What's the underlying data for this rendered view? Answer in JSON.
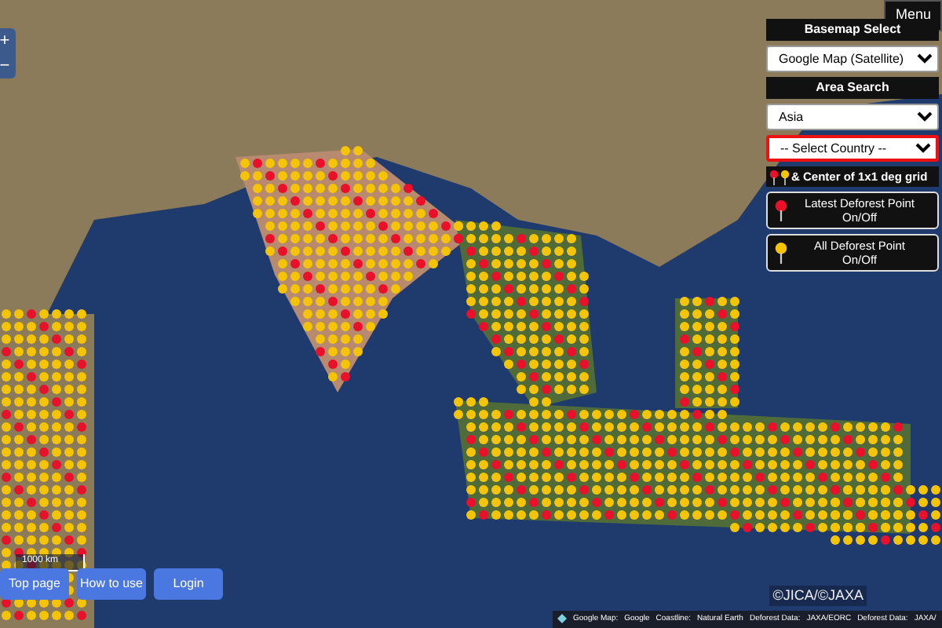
{
  "menu_button": "Menu",
  "zoom": {
    "zoom_in": "+",
    "zoom_out": "−"
  },
  "basemap": {
    "title": "Basemap Select",
    "value": "Google Map (Satellite)"
  },
  "area_search": {
    "title": "Area Search",
    "region": "Asia",
    "country": "-- Select Country --"
  },
  "legend": {
    "title": "& Center of 1x1 deg grid"
  },
  "toggles": [
    {
      "label": "Latest Deforest Point",
      "state_text": "On/Off",
      "color": "#e8102a"
    },
    {
      "label": "All Deforest Point",
      "state_text": "On/Off",
      "color": "#f5c400"
    }
  ],
  "scale": "1000 km",
  "nav_buttons": [
    "Top page",
    "How to use",
    "Login"
  ],
  "copyright": "©JICA/©JAXA",
  "attribution": [
    {
      "label": "Google Map:",
      "link": "Google"
    },
    {
      "label": "Coastline:",
      "link": "Natural Earth"
    },
    {
      "label": "Deforest Data:",
      "link": "JAXA/EORC"
    },
    {
      "label": "Deforest Data:",
      "link": "JAXA/"
    }
  ]
}
